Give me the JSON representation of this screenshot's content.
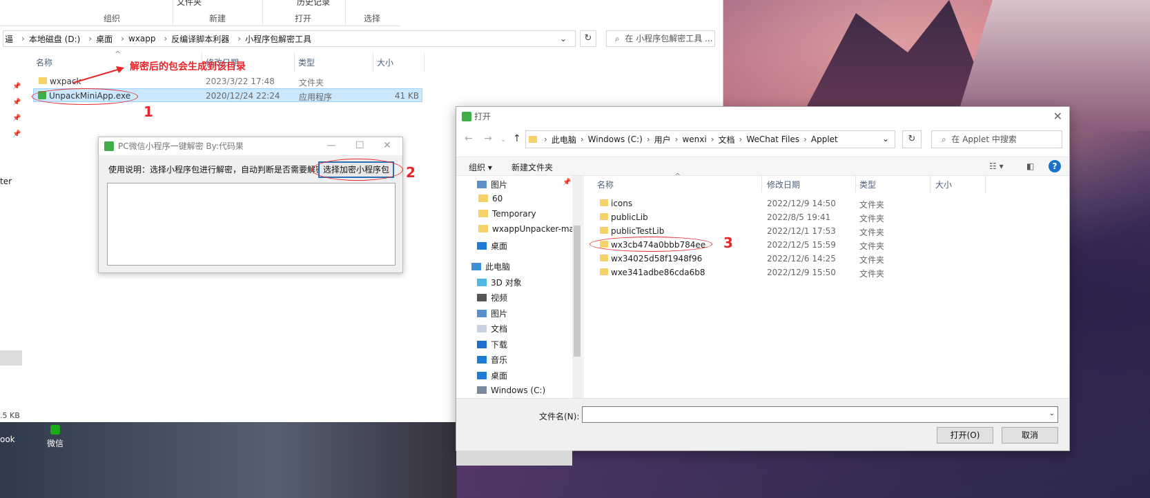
{
  "explorer": {
    "ribbon_top_labels": [
      "文件夹",
      "历史记录"
    ],
    "ribbon_groups": [
      "组织",
      "新建",
      "打开",
      "选择"
    ],
    "breadcrumb": [
      "本地磁盘 (D:)",
      "桌面",
      "wxapp",
      "反编译脚本利器",
      "小程序包解密工具"
    ],
    "breadcrumb_fragment": "逼",
    "search_placeholder": "在 小程序包解密工具 ...",
    "columns": [
      "名称",
      "修改日期",
      "类型",
      "大小"
    ],
    "files": [
      {
        "name": "wxpack",
        "date": "2023/3/22 17:48",
        "type": "文件夹",
        "size": ""
      },
      {
        "name": "UnpackMiniApp.exe",
        "date": "2020/12/24 22:24",
        "type": "应用程序",
        "size": "41 KB"
      }
    ],
    "left_fragment": "ter",
    "status_fragment": ".5 KB"
  },
  "annotations": {
    "note": "解密后的包会生成到该目录",
    "step1": "1",
    "step2": "2",
    "step3": "3"
  },
  "tool": {
    "title": "PC微信小程序一键解密 By:代码果",
    "hint": "使用说明：选择小程序包进行解密，自动判断是否需要解密",
    "pick_button": "选择加密小程序包"
  },
  "dialog": {
    "title": "打开",
    "breadcrumb": [
      "此电脑",
      "Windows (C:)",
      "用户",
      "wenxi",
      "文档",
      "WeChat Files",
      "Applet"
    ],
    "search_placeholder": "在 Applet 中搜索",
    "toolbar": {
      "organize": "组织 ▾",
      "new_folder": "新建文件夹"
    },
    "nav": [
      "图片",
      "60",
      "Temporary",
      "wxappUnpacker-mast",
      "桌面",
      "此电脑",
      "3D 对象",
      "视频",
      "图片",
      "文档",
      "下载",
      "音乐",
      "桌面",
      "Windows (C:)"
    ],
    "columns": [
      "名称",
      "修改日期",
      "类型",
      "大小"
    ],
    "rows": [
      {
        "name": "icons",
        "date": "2022/12/9 14:50",
        "type": "文件夹"
      },
      {
        "name": "publicLib",
        "date": "2022/8/5 19:41",
        "type": "文件夹"
      },
      {
        "name": "publicTestLib",
        "date": "2022/12/1 17:53",
        "type": "文件夹"
      },
      {
        "name": "wx3cb474a0bbb784ee",
        "date": "2022/12/5 15:59",
        "type": "文件夹"
      },
      {
        "name": "wx34025d58f1948f96",
        "date": "2022/12/6 14:25",
        "type": "文件夹"
      },
      {
        "name": "wxe341adbe86cda6b8",
        "date": "2022/12/9 15:50",
        "type": "文件夹"
      }
    ],
    "filename_label": "文件名(N):",
    "filename_value": "",
    "open_button": "打开(O)",
    "cancel_button": "取消"
  },
  "desktop": {
    "wechat_label": "微信",
    "look_fragment": "ook"
  },
  "colors": {
    "accent": "#2b6fb5",
    "annotation_red": "#e8262a",
    "selection": "#cce8ff",
    "folder": "#f6d36a",
    "app_icon": "#3fae49"
  }
}
